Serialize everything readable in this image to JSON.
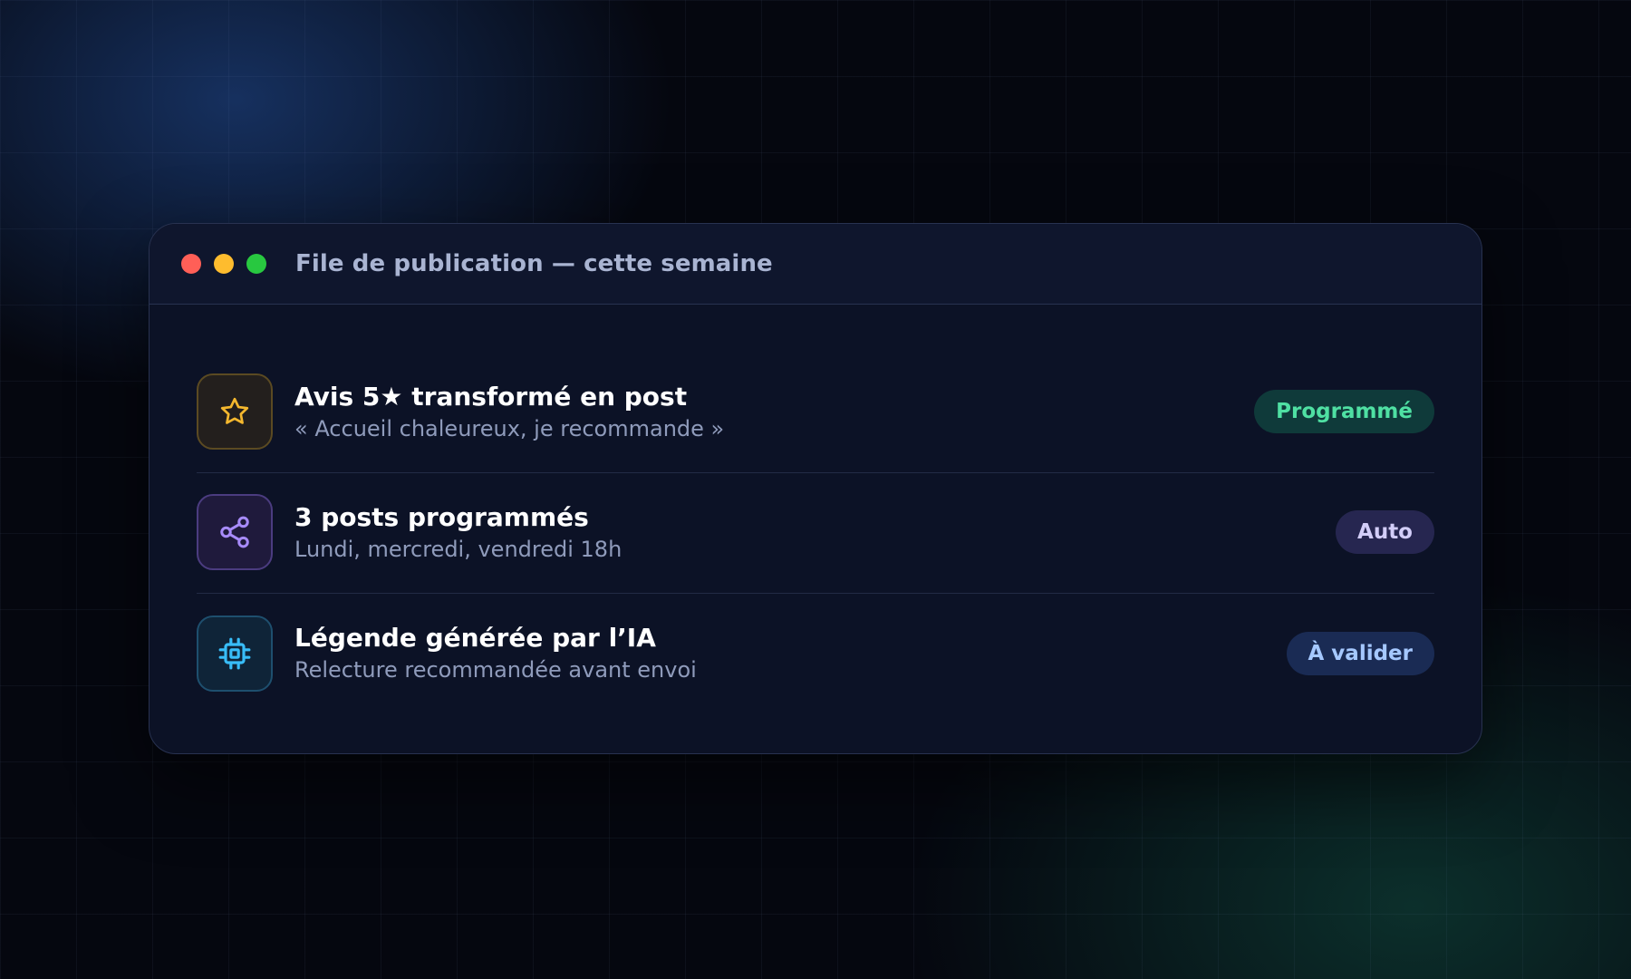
{
  "window": {
    "title": "File de publication — cette semaine",
    "controls": [
      "close",
      "minimize",
      "maximize"
    ]
  },
  "queue": {
    "items": [
      {
        "icon": "star-icon",
        "title": "Avis 5★ transformé en post",
        "subtitle": "« Accueil chaleureux, je recommande »",
        "status": "Programmé",
        "status_color": "#4fe0a3"
      },
      {
        "icon": "share-icon",
        "title": "3 posts programmés",
        "subtitle": "Lundi, mercredi, vendredi 18h",
        "status": "Auto",
        "status_color": "#d2cdf8"
      },
      {
        "icon": "chip-icon",
        "title": "Légende générée par l’IA",
        "subtitle": "Relecture recommandée avant envoi",
        "status": "À valider",
        "status_color": "#a5c8ff"
      }
    ]
  },
  "colors": {
    "background": "#05070f",
    "window": "#0c1226",
    "accent_gold": "#f5b82e",
    "accent_violet": "#a78bfa",
    "accent_cyan": "#38bdf8"
  }
}
